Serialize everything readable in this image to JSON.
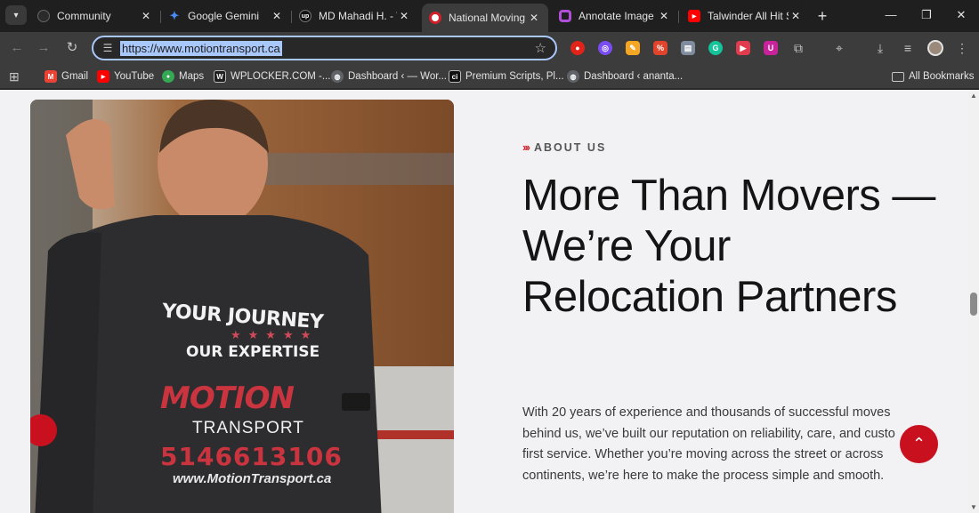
{
  "tabs": [
    {
      "title": "Community",
      "active": false,
      "favicon_color": "#2b2b2b"
    },
    {
      "title": "Google Gemini",
      "active": false,
      "favicon_color": "#4b8bf5"
    },
    {
      "title": "MD Mahadi H. - W",
      "active": false,
      "favicon_color": "#111111"
    },
    {
      "title": "National Moving C",
      "active": true,
      "favicon_color": "#d0202a"
    },
    {
      "title": "Annotate Image",
      "active": false,
      "favicon_color": "#b24fd8"
    },
    {
      "title": "Talwinder All Hit S",
      "active": false,
      "favicon_color": "#ff0000"
    }
  ],
  "tab_close_glyph": "✕",
  "new_tab_glyph": "+",
  "window": {
    "minimize": "—",
    "restore": "❐",
    "close": "✕"
  },
  "toolbar": {
    "back": "←",
    "forward": "→",
    "reload": "↻",
    "url": "https://www.motiontransport.ca",
    "site_icon": "☰",
    "star": "☆"
  },
  "extensions": [
    {
      "icon": "stop-sign-icon",
      "color": "#e2231a",
      "glyph": "●"
    },
    {
      "icon": "color-ring-icon",
      "color": "#7a4cf2",
      "glyph": "◎"
    },
    {
      "icon": "pencil-icon",
      "color": "#f5a623",
      "glyph": "✎"
    },
    {
      "icon": "percent-icon",
      "color": "#e0442c",
      "glyph": "%"
    },
    {
      "icon": "notes-icon",
      "color": "#7f8c9d",
      "glyph": "▤"
    },
    {
      "icon": "grammar-icon",
      "color": "#15c39a",
      "glyph": "G"
    },
    {
      "icon": "play-icon",
      "color": "#e23b4e",
      "glyph": "▶"
    },
    {
      "icon": "shield-icon",
      "color": "#c8239a",
      "glyph": "U"
    }
  ],
  "toolbar_icons": {
    "puzzle": "⧉",
    "lens": "⌖",
    "download": "⤓",
    "media": "≡",
    "menu": "⋮"
  },
  "bookmarks": [
    {
      "label": "Gmail",
      "icon": "gmail-icon",
      "color": "#ea4335",
      "glyph": "M"
    },
    {
      "label": "YouTube",
      "icon": "youtube-icon",
      "color": "#ff0000",
      "glyph": "▶"
    },
    {
      "label": "Maps",
      "icon": "maps-icon",
      "color": "#34a853",
      "glyph": "●"
    },
    {
      "label": "WPLOCKER.COM -...",
      "icon": "wplocker-icon",
      "color": "#1f1f1f",
      "glyph": "W"
    },
    {
      "label": "Dashboard ‹ — Wor...",
      "icon": "globe-icon",
      "color": "#5f6368",
      "glyph": "◍"
    },
    {
      "label": "Premium Scripts, Pl...",
      "icon": "ci-icon",
      "color": "#111111",
      "glyph": "ci"
    },
    {
      "label": "Dashboard ‹ ananta...",
      "icon": "globe-icon",
      "color": "#5f6368",
      "glyph": "◍"
    }
  ],
  "all_bookmarks": "All Bookmarks",
  "apps_glyph": "⊞",
  "page": {
    "eyebrow_chevrons": "›››",
    "eyebrow": "ABOUT US",
    "headline": "More Than Movers — We’re Your Relocation Partners",
    "body": "With 20 years of experience and thousands of successful moves\nbehind us, we’ve built our reputation on reliability, care, and custo\nfirst service. Whether you’re moving across the street or across\ncontinents, we’re here to make the process simple and smooth.",
    "back_to_top_glyph": "⌃",
    "shirt": {
      "line1": "YOUR JOURNEY",
      "line2": "OUR EXPERTISE",
      "brand": "MOTION",
      "brand_sub": "TRANSPORT",
      "phone": "5146613106",
      "website": "www.MotionTransport.ca"
    }
  },
  "colors": {
    "accent": "#c8101f",
    "page_bg": "#f2f1f4",
    "chrome_dark": "#1f1f1f",
    "chrome_mid": "#3c3c3c"
  }
}
